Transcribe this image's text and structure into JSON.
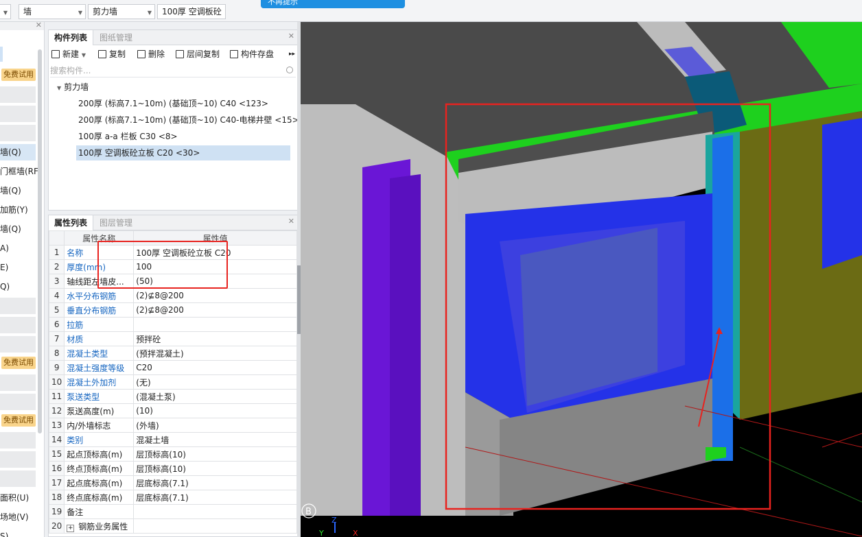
{
  "toolbar": {
    "combo1": "墙",
    "combo2": "剪力墙",
    "combo3": "100厚 空调板砼",
    "toast": "不再提示"
  },
  "left_strip": {
    "trial1": "免费试用",
    "trial2": "免费试用",
    "trial3": "免费试用",
    "items": [
      "墙(Q)",
      "门框墙(RF",
      "墙(Q)",
      "加筋(Y)",
      "墙(Q)",
      "A)",
      "E)",
      "Q)",
      "面积(U)",
      "场地(V)",
      "S)"
    ]
  },
  "component_panel": {
    "tab_list": "构件列表",
    "tab_drawings": "图纸管理",
    "buttons": {
      "new": "新建",
      "copy": "复制",
      "delete": "删除",
      "floor_copy": "层间复制",
      "save": "构件存盘"
    },
    "search_placeholder": "搜索构件...",
    "tree_root": "剪力墙",
    "items": [
      "200厚 (标高7.1~10m) (基础顶~10) C40 <123>",
      "200厚 (标高7.1~10m) (基础顶~10) C40-电梯井壁 <15>",
      "100厚 a-a 栏板 C30 <8>",
      "100厚 空调板砼立板 C20 <30>"
    ]
  },
  "property_panel": {
    "tab_props": "属性列表",
    "tab_layers": "图层管理",
    "col_name": "属性名称",
    "col_value": "属性值",
    "rows": [
      {
        "n": "1",
        "name": "名称",
        "value": "100厚 空调板砼立板 C20",
        "blue": true
      },
      {
        "n": "2",
        "name": "厚度(mm)",
        "value": "100",
        "blue": true
      },
      {
        "n": "3",
        "name": "轴线距左墙皮...",
        "value": "(50)",
        "blue": false
      },
      {
        "n": "4",
        "name": "水平分布钢筋",
        "value": "(2)⊈8@200",
        "blue": true
      },
      {
        "n": "5",
        "name": "垂直分布钢筋",
        "value": "(2)⊈8@200",
        "blue": true
      },
      {
        "n": "6",
        "name": "拉筋",
        "value": "",
        "blue": true
      },
      {
        "n": "7",
        "name": "材质",
        "value": "预拌砼",
        "blue": true
      },
      {
        "n": "8",
        "name": "混凝土类型",
        "value": "(预拌混凝土)",
        "blue": true
      },
      {
        "n": "9",
        "name": "混凝土强度等级",
        "value": "C20",
        "blue": true
      },
      {
        "n": "10",
        "name": "混凝土外加剂",
        "value": "(无)",
        "blue": true
      },
      {
        "n": "11",
        "name": "泵送类型",
        "value": "(混凝土泵)",
        "blue": true
      },
      {
        "n": "12",
        "name": "泵送高度(m)",
        "value": "(10)",
        "blue": false
      },
      {
        "n": "13",
        "name": "内/外墙标志",
        "value": "(外墙)",
        "blue": false
      },
      {
        "n": "14",
        "name": "类别",
        "value": "混凝土墙",
        "blue": true
      },
      {
        "n": "15",
        "name": "起点顶标高(m)",
        "value": "层顶标高(10)",
        "blue": false
      },
      {
        "n": "16",
        "name": "终点顶标高(m)",
        "value": "层顶标高(10)",
        "blue": false
      },
      {
        "n": "17",
        "name": "起点底标高(m)",
        "value": "层底标高(7.1)",
        "blue": false
      },
      {
        "n": "18",
        "name": "终点底标高(m)",
        "value": "层底标高(7.1)",
        "blue": false
      },
      {
        "n": "19",
        "name": "备注",
        "value": "",
        "blue": false
      },
      {
        "n": "20",
        "name": "钢筋业务属性",
        "value": "",
        "blue": false,
        "expand": "+"
      }
    ]
  },
  "viewport": {
    "axis_label": "B",
    "axis_z": "Z",
    "axis_y": "Y",
    "axis_x": "X",
    "colors": {
      "highlight": "#e8231f",
      "wall_purple": "#6a16d6",
      "window_blue": "#2432e8",
      "green_beam": "#1ed01e",
      "olive_wall": "#6b6b14",
      "teal_post": "#1aa59e"
    }
  }
}
